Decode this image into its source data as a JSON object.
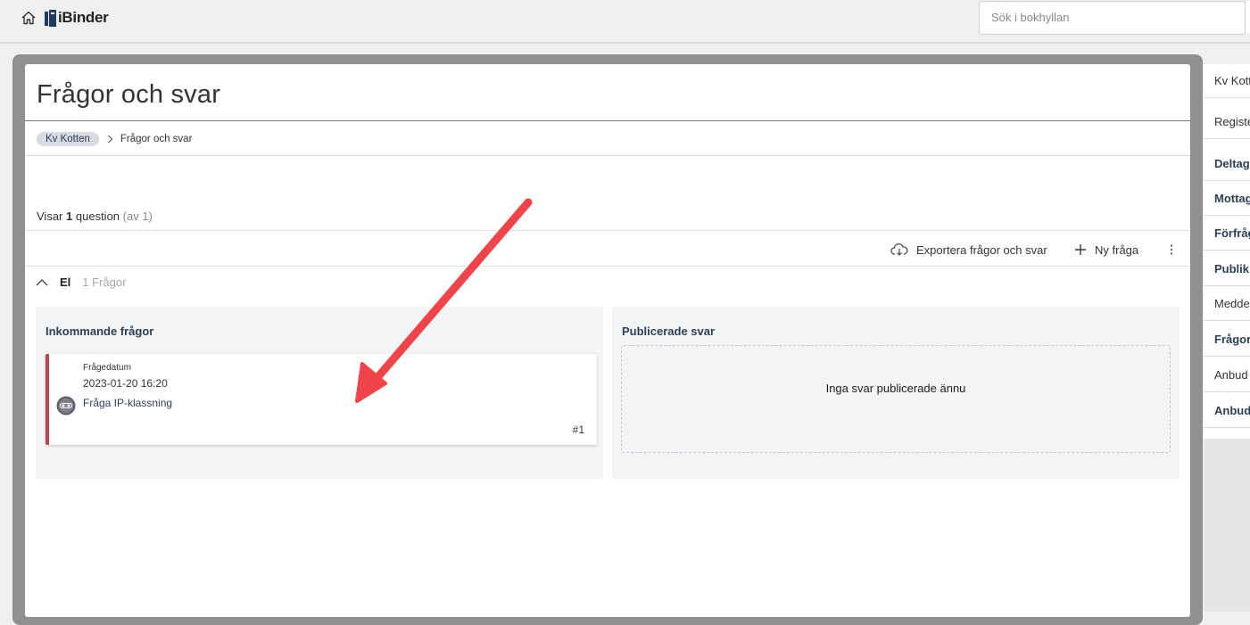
{
  "app": {
    "logo_text": "iBinder",
    "search_placeholder": "Sök i bokhyllan"
  },
  "page": {
    "title": "Frågor och svar",
    "breadcrumb": {
      "root": "Kv Kotten",
      "current": "Frågor och svar"
    },
    "count": {
      "prefix": "Visar",
      "number": "1",
      "unit": "question",
      "total": "(av 1)"
    }
  },
  "toolbar": {
    "export_label": "Exportera frågor och svar",
    "new_label": "Ny fråga"
  },
  "group": {
    "name": "El",
    "count_label": "1 Frågor",
    "expanded": true
  },
  "incoming": {
    "title": "Inkommande frågor",
    "questions": [
      {
        "date_label": "Frågedatum",
        "date": "2023-01-20 16:20",
        "title": "Fråga IP-klassning",
        "number": "#1",
        "accent_color": "#c0424a"
      }
    ]
  },
  "published": {
    "title": "Publicerade svar",
    "empty_text": "Inga svar publicerade ännu"
  },
  "sidebar": {
    "items": [
      {
        "label": "Kv Kott",
        "bold": false
      },
      {
        "label": "Registe",
        "bold": false
      },
      {
        "label": "Deltag",
        "bold": true
      },
      {
        "label": "Mottag",
        "bold": true
      },
      {
        "label": "Förfråg",
        "bold": true
      },
      {
        "label": "Publik",
        "bold": true
      },
      {
        "label": "Medde",
        "bold": false
      },
      {
        "label": "Frågor",
        "bold": true
      },
      {
        "label": "Anbud",
        "bold": false
      },
      {
        "label": "Anbud",
        "bold": true
      }
    ]
  },
  "colors": {
    "arrow": "#f0444b",
    "heading": "#2d3f55",
    "chip": "#d8dce2"
  }
}
